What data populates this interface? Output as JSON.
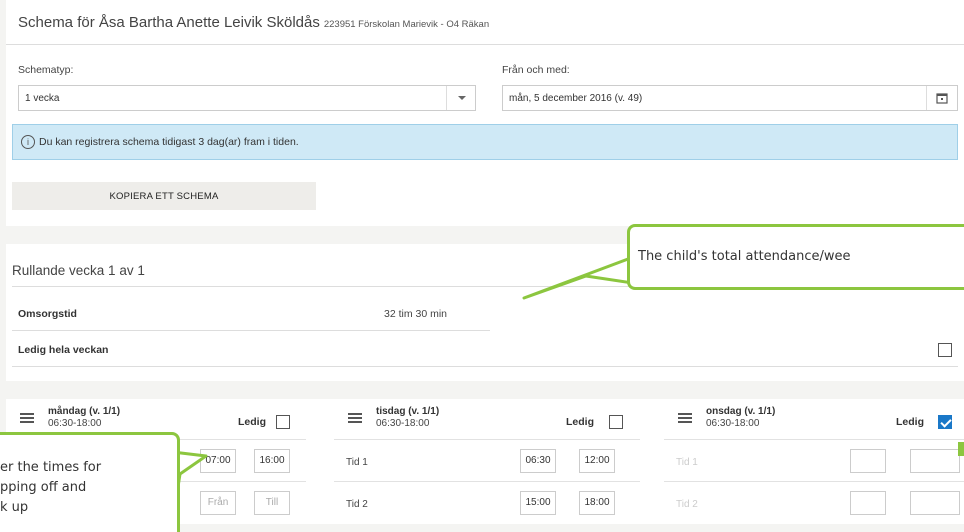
{
  "header": {
    "title": "Schema för Åsa Bartha Anette Leivik Sköldås",
    "subtitle": "223951 Förskolan Marievik - O4 Räkan"
  },
  "form": {
    "schematyp_label": "Schematyp:",
    "schematyp_value": "1 vecka",
    "fran_label": "Från och med:",
    "fran_value": "mån, 5 december 2016 (v. 49)"
  },
  "info": {
    "icon": "info-icon",
    "text": "Du kan registrera schema tidigast 3 dag(ar) fram i tiden."
  },
  "copy_button": "KOPIERA ETT SCHEMA",
  "schedule": {
    "rolling_title": "Rullande vecka 1 av 1",
    "omsorgstid_label": "Omsorgstid",
    "omsorgstid_value": "32 tim 30 min",
    "ledig_week_label": "Ledig hela veckan",
    "ledig_week_checked": false
  },
  "days": [
    {
      "name": "måndag (v. 1/1)",
      "hours": "06:30-18:00",
      "ledig_label": "Ledig",
      "ledig_checked": false,
      "tid1_from": "07:00",
      "tid1_to": "16:00",
      "tid2_from_placeholder": "Från",
      "tid2_to_placeholder": "Till"
    },
    {
      "name": "tisdag (v. 1/1)",
      "hours": "06:30-18:00",
      "ledig_label": "Ledig",
      "ledig_checked": false,
      "tid1_label": "Tid 1",
      "tid1_from": "06:30",
      "tid1_to": "12:00",
      "tid2_label": "Tid 2",
      "tid2_from": "15:00",
      "tid2_to": "18:00"
    },
    {
      "name": "onsdag (v. 1/1)",
      "hours": "06:30-18:00",
      "ledig_label": "Ledig",
      "ledig_checked": true,
      "tid1_label": "Tid 1",
      "tid2_label": "Tid 2"
    }
  ],
  "callouts": {
    "attendance": "The child's total attendance/wee",
    "times_line1": "er the times for",
    "times_line2": "pping off and",
    "times_line3": "k up"
  },
  "colors": {
    "accent_green": "#8cc63f",
    "info_bg": "#cfe9f6",
    "checkbox_blue": "#1a78c8"
  }
}
